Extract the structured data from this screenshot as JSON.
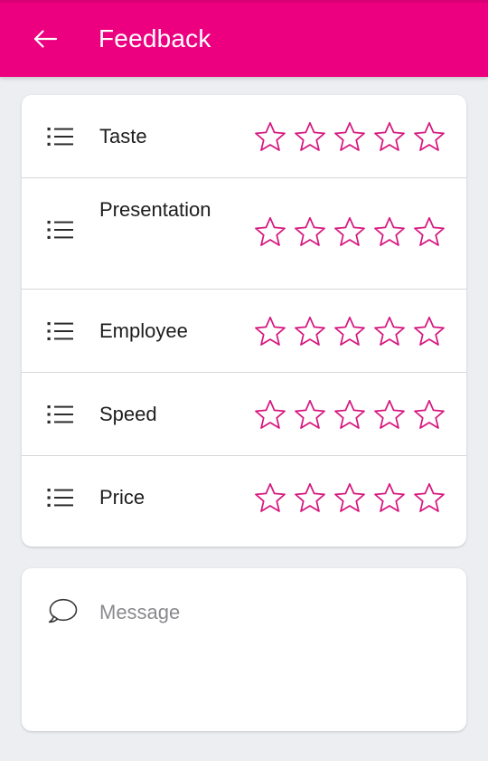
{
  "theme": {
    "accent": "#ec0080",
    "star_color": "#d6177f",
    "page_background": "#eceef2",
    "card_background": "#ffffff",
    "divider": "#d6d6d6",
    "title_color": "#ffffff",
    "label_color": "#1d1d1f",
    "placeholder_color": "#8a8a8e"
  },
  "appbar": {
    "title": "Feedback",
    "back_icon": "arrow-left-icon"
  },
  "ratings": {
    "icon": "bullet-list-icon",
    "max_stars": 5,
    "items": [
      {
        "label": "Taste",
        "value": 0,
        "stars": 5
      },
      {
        "label": "Presentation",
        "value": 0,
        "stars": 5
      },
      {
        "label": "Employee",
        "value": 0,
        "stars": 5
      },
      {
        "label": "Speed",
        "value": 0,
        "stars": 5
      },
      {
        "label": "Price",
        "value": 0,
        "stars": 5
      }
    ]
  },
  "message": {
    "icon": "speech-bubble-icon",
    "placeholder": "Message",
    "value": ""
  }
}
